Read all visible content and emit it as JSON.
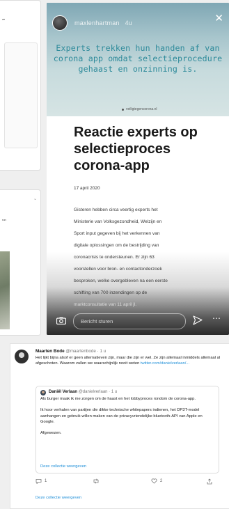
{
  "left_cards": {
    "card1_snippet": "ze",
    "card2_snippet": "ron"
  },
  "story": {
    "username": "maxlenhartman",
    "age": "4u",
    "headline": "Experts trekken hun handen af van corona app omdat selectieprocedure gehaast en onzinning is.",
    "article": {
      "source": "veiligtegencorona.nl",
      "title": "Reactie experts op selectieproces corona-app",
      "date": "17 april 2020",
      "body_lines": [
        "Gisteren hebben circa veertig experts het",
        "Ministerie van Volksgezondheid, Welzijn en",
        "Sport input gegeven bij het verkennen van",
        "digitale oplossingen om de bestrijding van",
        "coronacrisis te ondersteunen. Er zijn 63",
        "voorstellen voor bron- en contactonderzoek",
        "besproken, welke overgebleven na een eerste",
        "schifting van 700 inzendingen op de",
        "marktconsultatie van 11 april jl."
      ]
    },
    "reply_placeholder": "Bericht sturen",
    "icons": {
      "close": "close-icon",
      "camera": "camera-icon",
      "send": "send-icon",
      "more": "more-icon"
    }
  },
  "tweet": {
    "name": "Maarten Bode",
    "handle": "@maartenbode · 1 u",
    "text": "Het lijkt bijna alsof er geen alternatieven zijn, maar die zijn er wel. Ze zijn allemaal inmiddels allemaal al afgeschoten. Waarom zullen we waarschijnlijk nooit weten ",
    "text_link": "twitter.com/danielverlaan/...",
    "quote": {
      "name": "Daniël Verlaan",
      "handle": "@danielverlaan · 1 u",
      "paragraphs": [
        "Als burger maak ik me zorgen om de haast en het lobbyproces rondom de corona-app.",
        "Ik hoor verhalen van partijen die dikke technische whitepapers indienen, het DP3T-model aanhangen en gebruik willen maken van de privacyvriendelijke bluetooth-API van Apple en Google.",
        "Afgewezen."
      ],
      "collection_link": "Deze collectie weergeven"
    },
    "actions": {
      "reply_count": "1",
      "retweet_count": "",
      "like_count": "2"
    },
    "collection_link": "Deze collectie weergeven"
  },
  "colors": {
    "headline": "#2d8a9a",
    "link": "#1f8fd8",
    "story_bg": "#1c2022"
  }
}
